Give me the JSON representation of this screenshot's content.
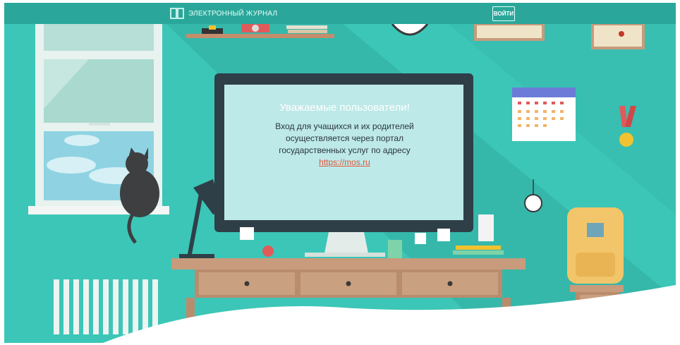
{
  "header": {
    "app_title": "ЭЛЕКТРОННЫЙ ЖУРНАЛ",
    "login_label": "ВОЙТИ"
  },
  "notice": {
    "title": "Уважаемые пользователи!",
    "line1": "Вход для учащихся и их родителей",
    "line2": "осуществляется через портал",
    "line3": "государственных услуг по адресу",
    "link_text": "https://mos.ru"
  },
  "colors": {
    "background": "#3cc6b7",
    "topbar": "#2aa79a",
    "screen": "#bde9e8",
    "link": "#e4573a",
    "desk": "#c79b7b"
  },
  "icons": [
    "book-icon"
  ]
}
